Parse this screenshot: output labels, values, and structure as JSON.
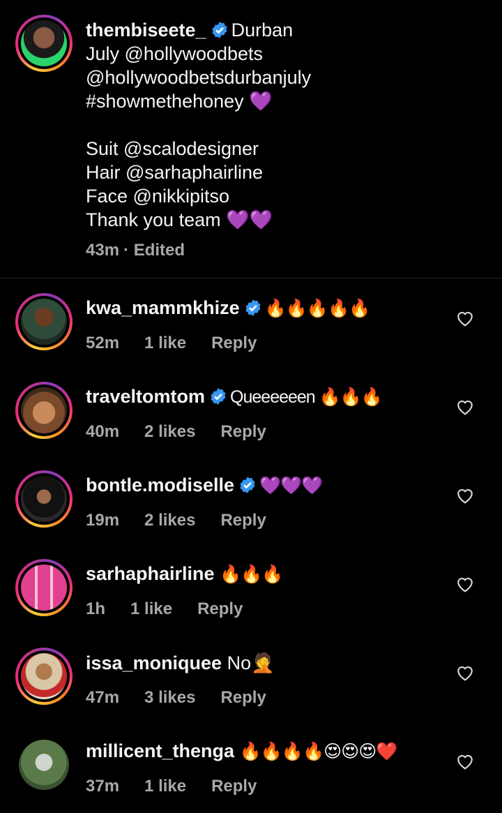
{
  "colors": {
    "background": "#000000",
    "text": "#f5f5f5",
    "muted": "#a8a8a8",
    "verified": "#3897f0"
  },
  "post": {
    "username": "thembiseete_",
    "verified": true,
    "caption_lines": [
      "Durban",
      "July @hollywoodbets",
      "@hollywoodbetsdurbanjuly",
      "#showmethehoney 💜",
      "",
      "Suit @scalodesigner",
      "Hair @sarhaphairline",
      "Face @nikkipitso",
      "Thank you team 💜💜"
    ],
    "time": "43m",
    "edited": "· Edited"
  },
  "comments": [
    {
      "username": "kwa_mammkhize",
      "verified": true,
      "text": "🔥🔥🔥🔥🔥",
      "time": "52m",
      "likes": "1 like",
      "reply": "Reply"
    },
    {
      "username": "traveltomtom",
      "verified": true,
      "text": "Queeeeeen 🔥🔥🔥",
      "time": "40m",
      "likes": "2 likes",
      "reply": "Reply"
    },
    {
      "username": "bontle.modiselle",
      "verified": true,
      "text": "💜💜💜",
      "time": "19m",
      "likes": "2 likes",
      "reply": "Reply"
    },
    {
      "username": "sarhaphairline",
      "verified": false,
      "text": "🔥🔥🔥",
      "time": "1h",
      "likes": "1 like",
      "reply": "Reply"
    },
    {
      "username": "issa_moniquee",
      "verified": false,
      "text": "No🤦",
      "time": "47m",
      "likes": "3 likes",
      "reply": "Reply"
    },
    {
      "username": "millicent_thenga",
      "verified": false,
      "text": "🔥🔥🔥🔥😍😍😍❤️",
      "time": "37m",
      "likes": "1 like",
      "reply": "Reply"
    }
  ]
}
